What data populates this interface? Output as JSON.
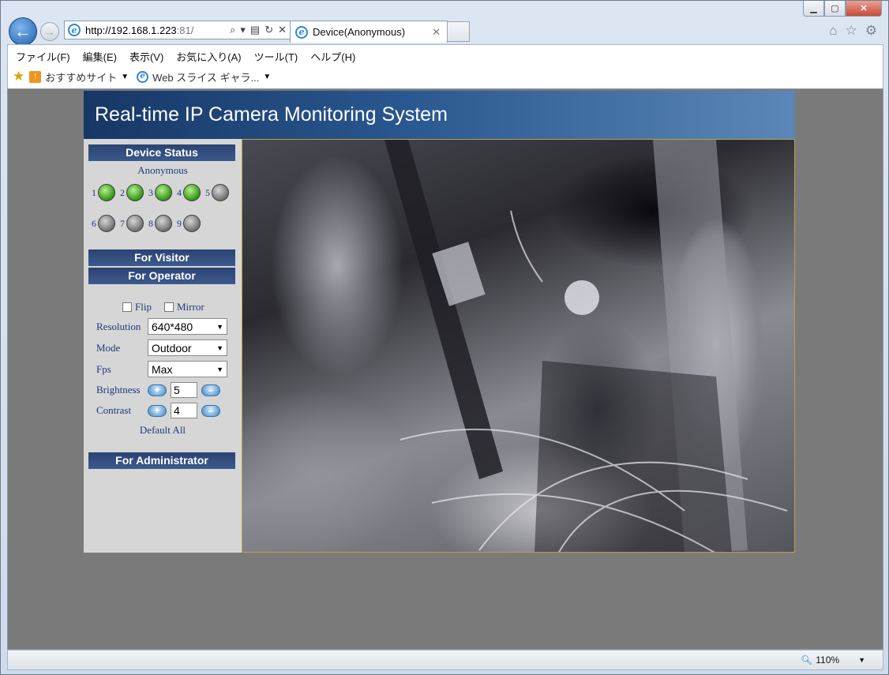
{
  "browser": {
    "url_host": "http://192.168.1.223",
    "url_port": ":81/",
    "tab_title": "Device(Anonymous)",
    "menus": [
      "ファイル(F)",
      "編集(E)",
      "表示(V)",
      "お気に入り(A)",
      "ツール(T)",
      "ヘルプ(H)"
    ],
    "favorites": {
      "suggested": "おすすめサイト",
      "webslice": "Web スライス ギャラ..."
    },
    "zoom": "110%"
  },
  "page": {
    "title": "Real-time IP Camera Monitoring System",
    "sidebar": {
      "device_status": "Device Status",
      "user": "Anonymous",
      "devices": [
        {
          "n": "1",
          "online": true
        },
        {
          "n": "2",
          "online": true
        },
        {
          "n": "3",
          "online": true
        },
        {
          "n": "4",
          "online": true
        },
        {
          "n": "5",
          "online": false
        },
        {
          "n": "6",
          "online": false
        },
        {
          "n": "7",
          "online": false
        },
        {
          "n": "8",
          "online": false
        },
        {
          "n": "9",
          "online": false
        }
      ],
      "for_visitor": "For Visitor",
      "for_operator": "For Operator",
      "flip": "Flip",
      "mirror": "Mirror",
      "resolution_label": "Resolution",
      "resolution_value": "640*480",
      "mode_label": "Mode",
      "mode_value": "Outdoor",
      "fps_label": "Fps",
      "fps_value": "Max",
      "brightness_label": "Brightness",
      "brightness_value": "5",
      "contrast_label": "Contrast",
      "contrast_value": "4",
      "default_all": "Default All",
      "for_administrator": "For Administrator"
    }
  },
  "colors": {
    "banner": "#29578f",
    "bar": "#2a4373",
    "led_on": "#3a9b1d",
    "led_off": "#777777",
    "viewport_bg": "#7b7a7b"
  }
}
